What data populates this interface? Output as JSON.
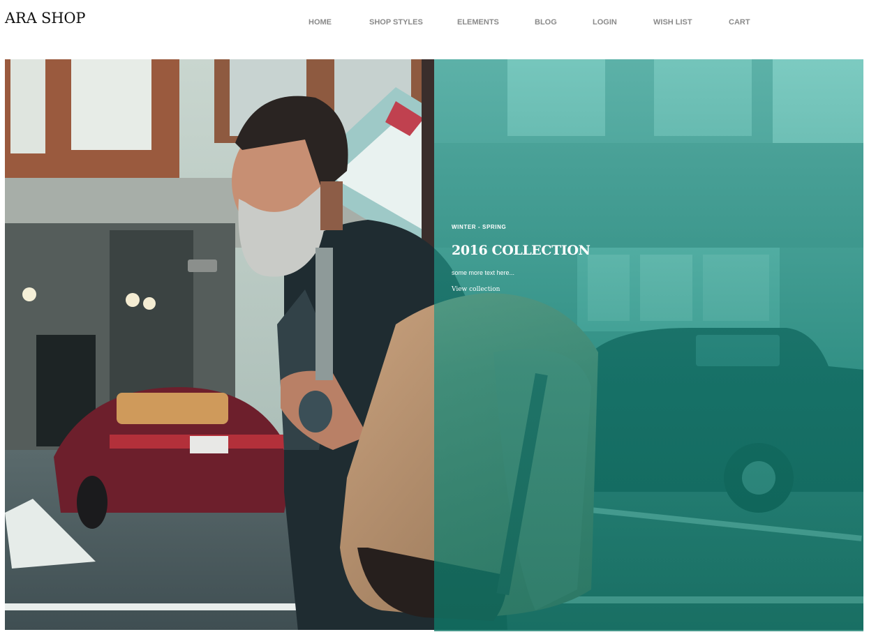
{
  "brand": {
    "logo_text": "ARA SHOP"
  },
  "nav": {
    "items": [
      {
        "label": "HOME"
      },
      {
        "label": "SHOP STYLES"
      },
      {
        "label": "ELEMENTS"
      },
      {
        "label": "BLOG"
      },
      {
        "label": "LOGIN"
      },
      {
        "label": "WISH LIST"
      },
      {
        "label": "CART"
      }
    ]
  },
  "hero": {
    "eyebrow": "WINTER - SPRING",
    "headline": "2016 COLLECTION",
    "subtext": "some more text here...",
    "cta_label": "View collection",
    "colors": {
      "overlay": "#1f9c8c",
      "text": "#ffffff",
      "nav_text": "#8a8a8a"
    }
  }
}
